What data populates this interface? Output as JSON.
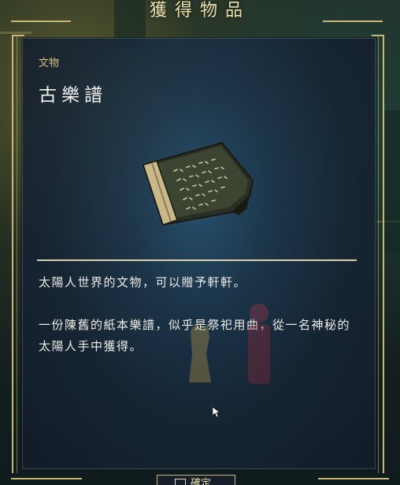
{
  "header": {
    "title": "獲得物品"
  },
  "item": {
    "category": "文物",
    "name": "古樂譜",
    "icon": "ancient-music-sheet-icon",
    "description": [
      "太陽人世界的文物，可以贈予軒軒。",
      "一份陳舊的紙本樂譜，似乎是祭祀用曲，從一名神秘的太陽人手中獲得。"
    ]
  },
  "footer": {
    "confirm_label": "確定"
  },
  "colors": {
    "gold": "#c9b67a",
    "panel": "#1c3a52",
    "text": "#ecebe6"
  }
}
